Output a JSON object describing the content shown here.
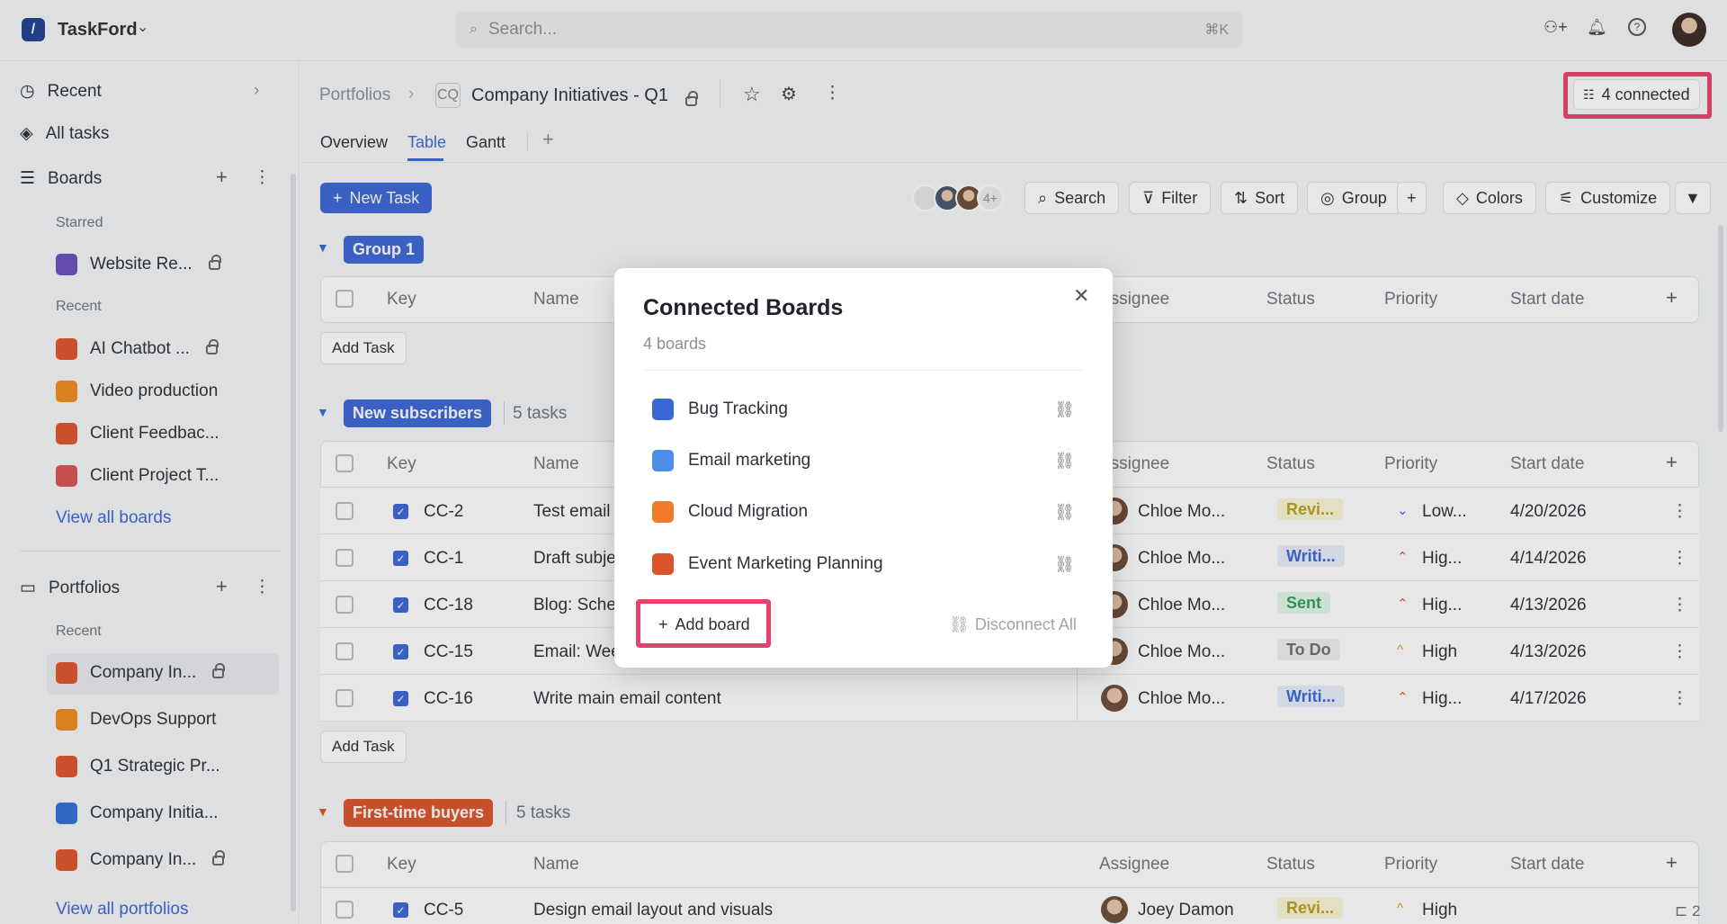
{
  "app": {
    "name": "TaskFord"
  },
  "search": {
    "placeholder": "Search...",
    "shortcut": "⌘K"
  },
  "sidebar": {
    "recent": "Recent",
    "all_tasks": "All tasks",
    "boards": "Boards",
    "starred": "Starred",
    "starred_items": [
      {
        "label": "Website Re...",
        "color": "#6a4fbf",
        "locked": true
      }
    ],
    "recent_sub": "Recent",
    "recent_boards": [
      {
        "label": "AI Chatbot ...",
        "color": "#e0552b",
        "locked": true
      },
      {
        "label": "Video production",
        "color": "#f28a1e",
        "locked": false
      },
      {
        "label": "Client Feedbac...",
        "color": "#e0552b",
        "locked": false
      },
      {
        "label": "Client Project T...",
        "color": "#d9534f",
        "locked": false
      }
    ],
    "view_all_boards": "View all boards",
    "portfolios": "Portfolios",
    "portfolios_recent": "Recent",
    "portfolio_items": [
      {
        "label": "Company In...",
        "color": "#e0552b",
        "locked": true
      },
      {
        "label": "DevOps Support",
        "color": "#f28a1e",
        "locked": false
      },
      {
        "label": "Q1 Strategic Pr...",
        "color": "#e0552b",
        "locked": false
      },
      {
        "label": "Company Initia...",
        "color": "#2f6fd6",
        "locked": false
      },
      {
        "label": "Company In...",
        "color": "#e0552b",
        "locked": true
      }
    ],
    "view_all_portfolios": "View all portfolios"
  },
  "header": {
    "breadcrumb_root": "Portfolios",
    "badge": "CQ",
    "title": "Company Initiatives - Q1",
    "connected": "4 connected"
  },
  "tabs": [
    "Overview",
    "Table",
    "Gantt"
  ],
  "toolbar": {
    "new_task": "New Task",
    "members_more": "4+",
    "search": "Search",
    "filter": "Filter",
    "sort": "Sort",
    "group": "Group",
    "colors": "Colors",
    "customize": "Customize"
  },
  "columns": {
    "key": "Key",
    "name": "Name",
    "assignee": "Assignee",
    "status": "Status",
    "priority": "Priority",
    "start": "Start date"
  },
  "add_task": "Add Task",
  "groups": [
    {
      "label": "Group 1",
      "color": "#3b66d6",
      "count": ""
    },
    {
      "label": "New subscribers",
      "color": "#3b66d6",
      "count": "5 tasks"
    },
    {
      "label": "First-time buyers",
      "color": "#d9542a",
      "count": "5 tasks"
    }
  ],
  "rows": [
    {
      "key": "CC-2",
      "name": "Test email",
      "assignee": "Chloe Mo...",
      "status": "Revi...",
      "status_color": "#b8a21a",
      "status_bg": "#fbf6d6",
      "priority": "Low...",
      "priority_icon": "⌄",
      "priority_color": "#3b66d6",
      "start": "4/20/2026"
    },
    {
      "key": "CC-1",
      "name": "Draft subje",
      "assignee": "Chloe Mo...",
      "status": "Writi...",
      "status_color": "#3b66d6",
      "status_bg": "#e6eefc",
      "priority": "Hig...",
      "priority_icon": "⌃",
      "priority_color": "#e0553b",
      "start": "4/14/2026"
    },
    {
      "key": "CC-18",
      "name": "Blog: Sche",
      "assignee": "Chloe Mo...",
      "status": "Sent",
      "status_color": "#2f9e5b",
      "status_bg": "#e3f6ea",
      "priority": "Hig...",
      "priority_icon": "⌃",
      "priority_color": "#e0553b",
      "start": "4/13/2026"
    },
    {
      "key": "CC-15",
      "name": "Email: Wee",
      "assignee": "Chloe Mo...",
      "status": "To Do",
      "status_color": "#6b6f76",
      "status_bg": "#eeeff1",
      "priority": "High",
      "priority_icon": "^",
      "priority_color": "#f0902f",
      "start": "4/13/2026"
    },
    {
      "key": "CC-16",
      "name": "Write main email content",
      "assignee": "Chloe Mo...",
      "status": "Writi...",
      "status_color": "#3b66d6",
      "status_bg": "#e6eefc",
      "priority": "Hig...",
      "priority_icon": "⌃",
      "priority_color": "#e0553b",
      "start": "4/17/2026"
    }
  ],
  "group3_row": {
    "key": "CC-5",
    "name": "Design email layout and visuals",
    "assignee": "Joey Damon",
    "status": "Revi...",
    "status_color": "#b8a21a",
    "status_bg": "#fbf6d6",
    "priority": "High",
    "priority_icon": "^",
    "priority_color": "#f0902f",
    "subtasks": "2"
  },
  "modal": {
    "title": "Connected Boards",
    "subtitle": "4 boards",
    "boards": [
      {
        "label": "Bug Tracking",
        "color": "#3b66d6"
      },
      {
        "label": "Email marketing",
        "color": "#4b8de8"
      },
      {
        "label": "Cloud Migration",
        "color": "#f07c2a"
      },
      {
        "label": "Event Marketing Planning",
        "color": "#d9542a"
      }
    ],
    "add_board": "Add board",
    "disconnect_all": "Disconnect All"
  }
}
